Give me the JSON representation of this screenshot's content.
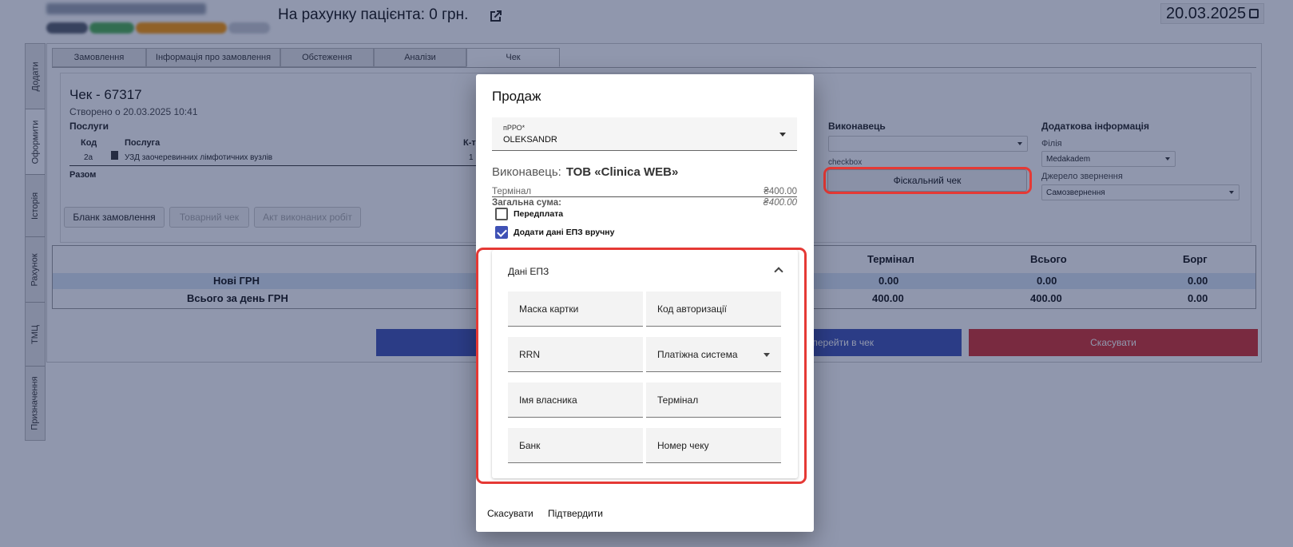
{
  "header": {
    "balance": "На рахунку пацієнта: 0 грн.",
    "date": "20.03.2025"
  },
  "side_tabs": [
    "Додати",
    "Оформити",
    "Історія",
    "Рахунок",
    "ТМЦ",
    "Призначення"
  ],
  "tabs": [
    "Замовлення",
    "Інформація про замовлення",
    "Обстеження",
    "Аналізи",
    "Чек"
  ],
  "receipt": {
    "title": "Чек - 67317",
    "created": "Створено о 20.03.2025 10:41",
    "services_heading": "Послуги",
    "col_code": "Код",
    "col_service": "Послуга",
    "col_qty": "К-т",
    "row_code": "2а",
    "row_service": "УЗД заочеревинних лімфотичних вузлів",
    "row_qty": "1",
    "total_label": "Разом",
    "btn_order_form": "Бланк замовлення",
    "btn_goods_receipt": "Товарний чек",
    "btn_act": "Акт виконаних робіт"
  },
  "executor_section": {
    "heading": "Виконавець",
    "checkbox_text": "checkbox",
    "fiscal_button": "Фіскальний чек"
  },
  "extra_info": {
    "heading": "Додаткова інформація",
    "branch_label": "Філія",
    "branch_value": "Medakadem",
    "source_label": "Джерело звернення",
    "source_value": "Самозвернення"
  },
  "totals": {
    "headers": {
      "terminal": "Термінал",
      "total": "Всього",
      "debt": "Борг"
    },
    "rows": [
      {
        "label": "Нові ГРН",
        "terminal": "0.00",
        "total": "0.00",
        "debt": "0.00"
      },
      {
        "label": "Всього за день ГРН",
        "terminal": "400.00",
        "total": "400.00",
        "debt": "0.00"
      }
    ]
  },
  "bottom_bar": {
    "go_to_receipt": "перейти в чек",
    "cancel": "Скасувати"
  },
  "dialog": {
    "title": "Продаж",
    "prro_label": "пРРО*",
    "prro_value": "OLEKSANDR",
    "executor_label": "Виконавець:",
    "executor_value": "ТОВ «Clinica WEB»",
    "terminal_label": "Термінал",
    "terminal_value": "₴400.00",
    "total_label": "Загальна сума:",
    "total_value": "₴400.00",
    "overpay_label": "Передплата",
    "overpay_checked": false,
    "epz_manual_label": "Додати дані ЕПЗ вручну",
    "epz_manual_checked": true,
    "epz": {
      "title": "Дані ЕПЗ",
      "card_mask": "Маска картки",
      "auth_code": "Код авторизації",
      "rrn": "RRN",
      "payment_system": "Платіжна система",
      "owner_name": "Імя власника",
      "terminal": "Термінал",
      "bank": "Банк",
      "receipt_number": "Номер чеку"
    },
    "cancel": "Скасувати",
    "confirm": "Підтвердити"
  },
  "colors": {
    "primary": "#3f51b5",
    "danger": "#d32f2f",
    "highlight_ring": "#e53935"
  }
}
